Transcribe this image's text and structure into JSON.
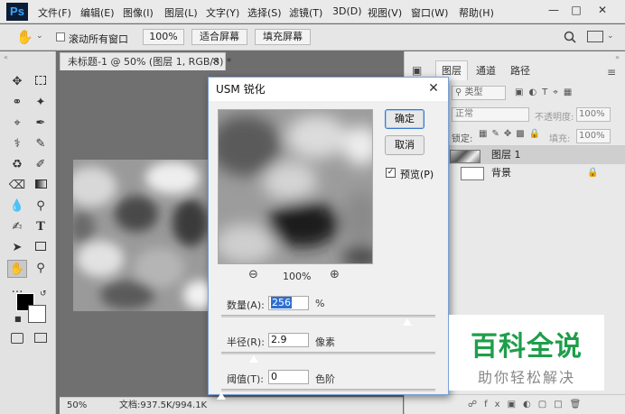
{
  "app": {
    "logo": "Ps",
    "menu": [
      "文件(F)",
      "编辑(E)",
      "图像(I)",
      "图层(L)",
      "文字(Y)",
      "选择(S)",
      "滤镜(T)",
      "3D(D)",
      "视图(V)",
      "窗口(W)",
      "帮助(H)"
    ],
    "window_controls": [
      "minimize-icon",
      "maximize-icon",
      "close-icon"
    ]
  },
  "options_bar": {
    "scroll_all_windows": "滚动所有窗口",
    "scroll_all_checked": false,
    "zoom_100": "100%",
    "fit_screen": "适合屏幕",
    "fill_screen": "填充屏幕"
  },
  "document": {
    "tab_title": "未标题-1 @ 50% (图层 1, RGB/8) *",
    "zoom": "50%",
    "doc_size": "文档:937.5K/994.1K"
  },
  "panel": {
    "tabs": [
      "图层",
      "通道",
      "路径"
    ],
    "active_tab": "图层",
    "filter_kind": "类型",
    "blend_mode": "正常",
    "opacity_label": "不透明度:",
    "opacity_value": "100%",
    "lock_label": "锁定:",
    "fill_label": "填充:",
    "fill_value": "100%",
    "layers": [
      {
        "name": "图层 1",
        "selected": true
      },
      {
        "name": "背景",
        "selected": false,
        "locked": true
      }
    ]
  },
  "dialog": {
    "title": "USM 锐化",
    "ok": "确定",
    "cancel": "取消",
    "preview_label": "预览(P)",
    "preview_checked": true,
    "zoom_level": "100%",
    "amount_label": "数量(A):",
    "amount_value": "256",
    "amount_unit": "%",
    "amount_slider_fraction": 0.87,
    "radius_label": "半径(R):",
    "radius_value": "2.9",
    "radius_unit": "像素",
    "radius_slider_fraction": 0.15,
    "threshold_label": "阈值(T):",
    "threshold_value": "0",
    "threshold_unit": "色阶",
    "threshold_slider_fraction": 0.0
  },
  "watermark": {
    "title": "百科全说",
    "subtitle": "助你轻松解决"
  }
}
